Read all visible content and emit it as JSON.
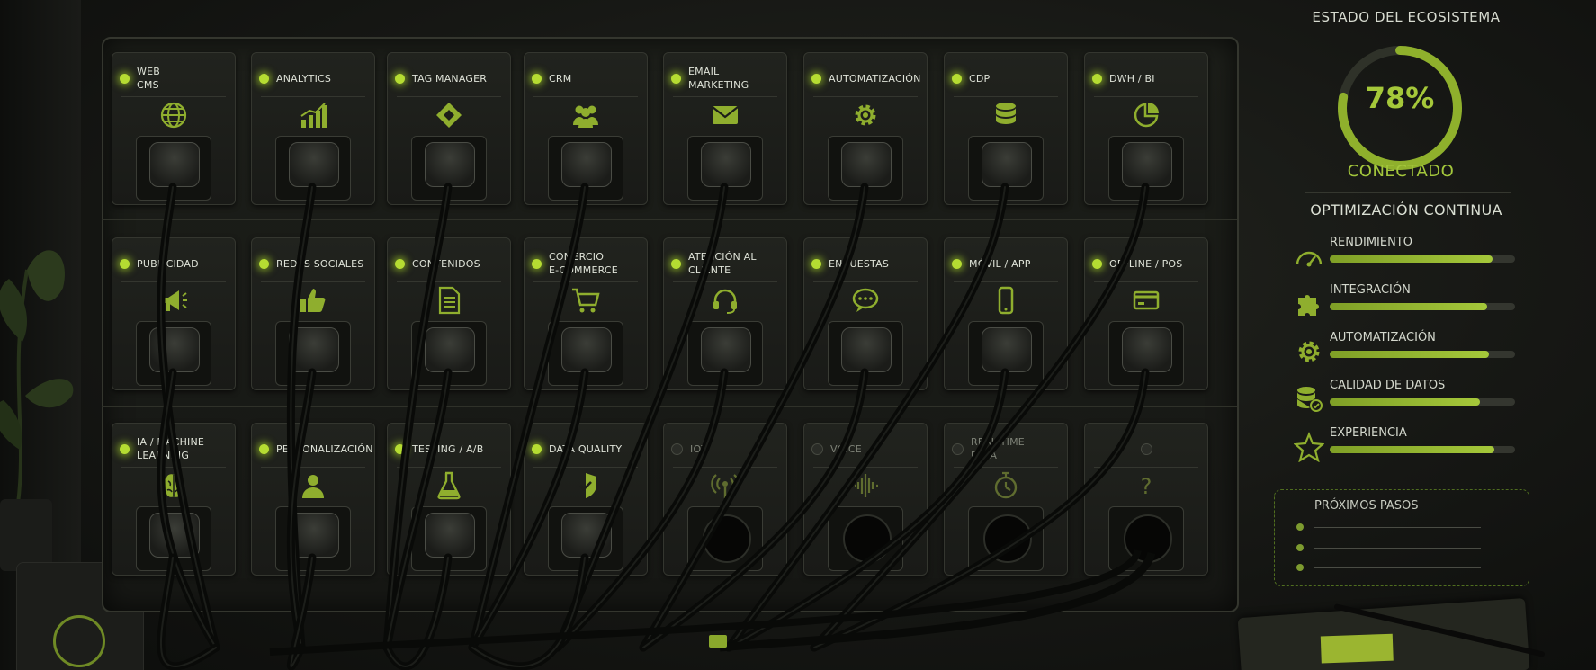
{
  "sidebar": {
    "title": "ESTADO DEL ECOSISTEMA",
    "percent": "78%",
    "percent_value": 78,
    "status": "CONECTADO",
    "optimization_title": "OPTIMIZACIÓN CONTINUA",
    "metrics": [
      {
        "label": "RENDIMIENTO",
        "value": 0.88,
        "icon": "speedometer-icon"
      },
      {
        "label": "INTEGRACIÓN",
        "value": 0.85,
        "icon": "puzzle-icon"
      },
      {
        "label": "AUTOMATIZACIÓN",
        "value": 0.86,
        "icon": "gear-icon"
      },
      {
        "label": "CALIDAD DE DATOS",
        "value": 0.81,
        "icon": "database-check-icon"
      },
      {
        "label": "EXPERIENCIA",
        "value": 0.89,
        "icon": "star-icon"
      }
    ],
    "next_steps_title": "PRÓXIMOS PASOS"
  },
  "modules": [
    {
      "line1": "WEB",
      "line2": "CMS",
      "icon": "globe-icon",
      "on": true,
      "plugged": true
    },
    {
      "line1": "ANALYTICS",
      "line2": "",
      "icon": "bar-chart-icon",
      "on": true,
      "plugged": true
    },
    {
      "line1": "TAG MANAGER",
      "line2": "",
      "icon": "diamond-tag-icon",
      "on": true,
      "plugged": true
    },
    {
      "line1": "CRM",
      "line2": "",
      "icon": "users-icon",
      "on": true,
      "plugged": true
    },
    {
      "line1": "EMAIL",
      "line2": "MARKETING",
      "icon": "envelope-icon",
      "on": true,
      "plugged": true
    },
    {
      "line1": "AUTOMATIZACIÓN",
      "line2": "",
      "icon": "gear-icon",
      "on": true,
      "plugged": true
    },
    {
      "line1": "CDP",
      "line2": "",
      "icon": "database-icon",
      "on": true,
      "plugged": true
    },
    {
      "line1": "DWH / BI",
      "line2": "",
      "icon": "pie-chart-icon",
      "on": true,
      "plugged": true
    },
    {
      "line1": "PUBLICIDAD",
      "line2": "",
      "icon": "megaphone-icon",
      "on": true,
      "plugged": true
    },
    {
      "line1": "REDES SOCIALES",
      "line2": "",
      "icon": "thumbs-up-icon",
      "on": true,
      "plugged": true
    },
    {
      "line1": "CONTENIDOS",
      "line2": "",
      "icon": "document-icon",
      "on": true,
      "plugged": true
    },
    {
      "line1": "COMERCIO",
      "line2": "E-COMMERCE",
      "icon": "cart-icon",
      "on": true,
      "plugged": true
    },
    {
      "line1": "ATENCIÓN AL CLIENTE",
      "line2": "",
      "icon": "headset-icon",
      "on": true,
      "plugged": true
    },
    {
      "line1": "ENCUESTAS",
      "line2": "",
      "icon": "chat-bubble-icon",
      "on": true,
      "plugged": true
    },
    {
      "line1": "MÓVIL / APP",
      "line2": "",
      "icon": "smartphone-icon",
      "on": true,
      "plugged": true
    },
    {
      "line1": "OFFLINE / POS",
      "line2": "",
      "icon": "card-terminal-icon",
      "on": true,
      "plugged": true
    },
    {
      "line1": "IA / MACHINE",
      "line2": "LEARNING",
      "icon": "brain-icon",
      "on": true,
      "plugged": true
    },
    {
      "line1": "PERSONALIZACIÓN",
      "line2": "",
      "icon": "person-icon",
      "on": true,
      "plugged": true
    },
    {
      "line1": "TESTING / A/B",
      "line2": "",
      "icon": "flask-icon",
      "on": true,
      "plugged": true
    },
    {
      "line1": "DATA QUALITY",
      "line2": "",
      "icon": "shield-check-icon",
      "on": true,
      "plugged": true
    },
    {
      "line1": "IOT",
      "line2": "",
      "icon": "broadcast-icon",
      "on": false,
      "plugged": false
    },
    {
      "line1": "VOICE",
      "line2": "",
      "icon": "soundwave-icon",
      "on": false,
      "plugged": false
    },
    {
      "line1": "REAL TIME",
      "line2": "DATA",
      "icon": "stopwatch-icon",
      "on": false,
      "plugged": false
    },
    {
      "line1": "",
      "line2": "",
      "icon": "question-mark-icon",
      "on": false,
      "plugged": false,
      "glyph": "?"
    }
  ],
  "colors": {
    "accent": "#a5c83a",
    "led_on": "#b5dc32",
    "icon": "#8fae2e",
    "background": "#161714"
  }
}
